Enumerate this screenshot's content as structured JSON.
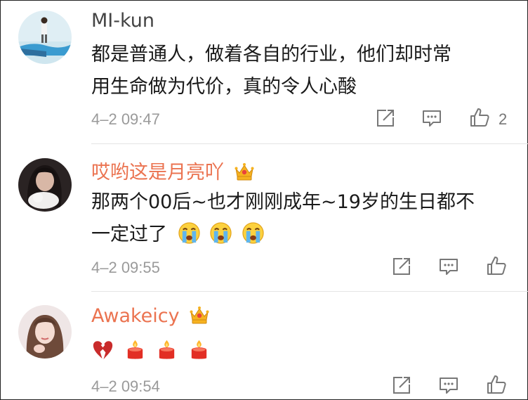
{
  "comments": [
    {
      "username": "MI-kun",
      "verified_crown": false,
      "text_lines": [
        "都是普通人，做着各自的行业，他们却时常",
        "用生命做为代价，真的令人心酸"
      ],
      "time": "4–2 09:47",
      "likes": "2",
      "icons": [
        "repost-icon",
        "reply-icon",
        "like-icon"
      ]
    },
    {
      "username": "哎哟这是月亮吖",
      "verified_crown": true,
      "text_lines": [
        "那两个00后~也才刚刚成年~19岁的生日都不",
        "一定过了"
      ],
      "emoji_after_text": [
        "crying-face-emoji",
        "crying-face-emoji",
        "crying-face-emoji"
      ],
      "time": "4–2 09:55",
      "likes": "",
      "icons": [
        "repost-icon",
        "reply-icon",
        "like-icon"
      ]
    },
    {
      "username": "Awakeicy",
      "verified_crown": true,
      "emojis": [
        "broken-heart-emoji",
        "candle-emoji",
        "candle-emoji",
        "candle-emoji"
      ],
      "time": "4–2 09:54",
      "likes": "",
      "icons": [
        "repost-icon",
        "reply-icon",
        "like-icon"
      ]
    }
  ],
  "colors": {
    "vip_name": "#eb7350",
    "plain_name": "#444444",
    "timestamp": "#9a9a9a",
    "icon": "#777777",
    "divider": "#e4e4e4"
  }
}
